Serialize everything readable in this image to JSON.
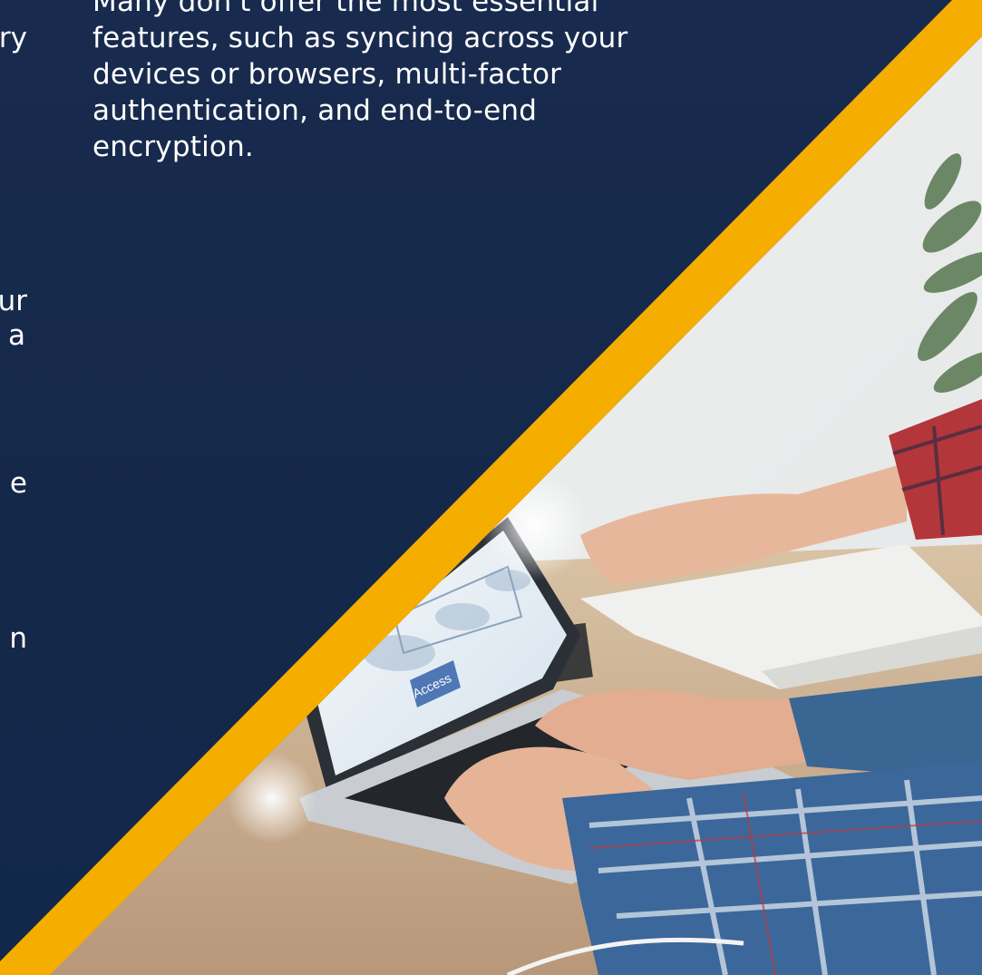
{
  "left_panel": {
    "main_text": "Many don't offer the most essential\nfeatures, such as syncing across your\ndevices or browsers, multi-factor\nauthentication, and end-to-end\nencryption.",
    "clipped_fragments": [
      "ry",
      "ur",
      "a",
      "e",
      "n"
    ]
  },
  "photo": {
    "screen_button_label": "Access"
  },
  "colors": {
    "panel": "#162b4d",
    "accent_stripe": "#f5ad00",
    "text": "#ffffff"
  }
}
